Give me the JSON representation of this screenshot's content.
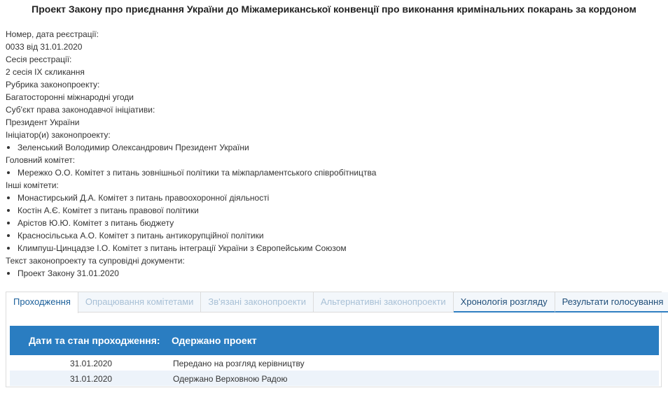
{
  "title": "Проект Закону про приєднання України до Міжамериканської конвенції про виконання кримінальних покарань за кордоном",
  "meta": {
    "reg_label": "Номер, дата реєстрації:",
    "reg_value": "0033 від 31.01.2020",
    "session_label": "Сесія реєстрації:",
    "session_value": "2 сесія IX скликання",
    "rubric_label": "Рубрика законопроекту:",
    "rubric_value": "Багатосторонні міжнародні угоди",
    "subject_label": "Суб'єкт права законодавчої ініціативи:",
    "subject_value": "Президент України",
    "initiators_label": "Ініціатор(и) законопроекту:",
    "initiators": [
      "Зеленський Володимир Олександрович Президент України"
    ],
    "main_committee_label": "Головний комітет:",
    "main_committee": [
      "Мережко О.О. Комітет з питань зовнішньої політики та міжпарламентського співробітництва"
    ],
    "other_committees_label": "Інші комітети:",
    "other_committees": [
      "Монастирський Д.А. Комітет з питань правоохоронної діяльності",
      "Костін А.Є. Комітет з питань правової політики",
      "Арістов Ю.Ю. Комітет з питань бюджету",
      "Красносільська А.О. Комітет з питань антикорупційної політики",
      "Климпуш-Цинцадзе І.О. Комітет з питань інтеграції України з Європейським Союзом"
    ],
    "docs_label": "Текст законопроекту та супровідні документи:",
    "docs": [
      "Проект Закону 31.01.2020"
    ]
  },
  "tabs": [
    {
      "label": "Проходження",
      "state": "active"
    },
    {
      "label": "Опрацювання комітетами",
      "state": "disabled"
    },
    {
      "label": "Зв'язані законопроекти",
      "state": "disabled"
    },
    {
      "label": "Альтернативні законопроекти",
      "state": "disabled"
    },
    {
      "label": "Хронологія розгляду",
      "state": "link"
    },
    {
      "label": "Результати голосування",
      "state": "link"
    }
  ],
  "table": {
    "headers": [
      "Дати та стан проходження:",
      "Одержано проект"
    ],
    "rows": [
      {
        "date": "31.01.2020",
        "status": "Передано на розгляд керівництву"
      },
      {
        "date": "31.01.2020",
        "status": "Одержано Верховною Радою"
      }
    ]
  },
  "colors": {
    "header_blue": "#2a7dc1",
    "tab_text": "#1a5f9a",
    "row_alt": "#edf3fa"
  }
}
